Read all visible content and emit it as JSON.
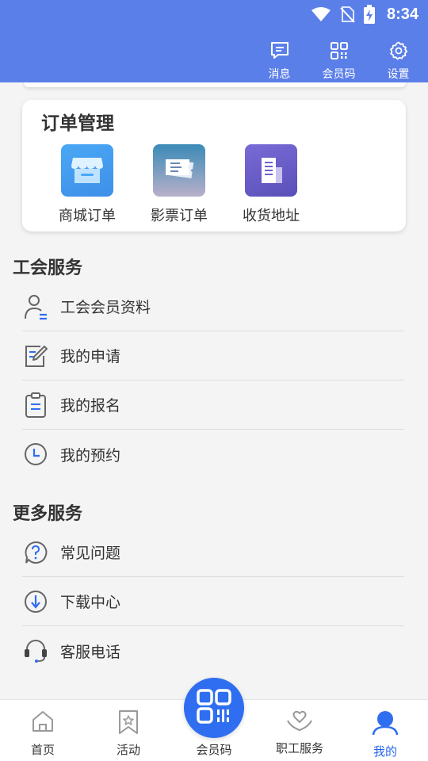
{
  "status_bar": {
    "time": "8:34"
  },
  "header": {
    "actions": [
      {
        "label": "消息",
        "icon": "message-icon"
      },
      {
        "label": "会员码",
        "icon": "qr-code-icon"
      },
      {
        "label": "设置",
        "icon": "gear-icon"
      }
    ]
  },
  "order_management": {
    "title": "订单管理",
    "items": [
      {
        "label": "商城订单",
        "icon": "store-icon"
      },
      {
        "label": "影票订单",
        "icon": "ticket-icon"
      },
      {
        "label": "收货地址",
        "icon": "building-icon"
      }
    ]
  },
  "union_services": {
    "title": "工会服务",
    "items": [
      {
        "label": "工会会员资料",
        "icon": "member-profile-icon"
      },
      {
        "label": "我的申请",
        "icon": "edit-form-icon"
      },
      {
        "label": "我的报名",
        "icon": "clipboard-icon"
      },
      {
        "label": "我的预约",
        "icon": "clock-icon"
      }
    ]
  },
  "more_services": {
    "title": "更多服务",
    "items": [
      {
        "label": "常见问题",
        "icon": "question-icon"
      },
      {
        "label": "下载中心",
        "icon": "download-icon"
      },
      {
        "label": "客服电话",
        "icon": "headset-icon"
      }
    ]
  },
  "bottom_nav": {
    "items": [
      {
        "label": "首页",
        "icon": "home-icon"
      },
      {
        "label": "活动",
        "icon": "bookmark-star-icon"
      },
      {
        "label": "会员码",
        "icon": "qr-code-icon"
      },
      {
        "label": "职工服务",
        "icon": "heart-hands-icon"
      },
      {
        "label": "我的",
        "icon": "user-icon"
      }
    ],
    "active": "我的"
  },
  "colors": {
    "header_bg": "#5b7fe8",
    "accent": "#2f6ef0",
    "active_nav": "#2563eb"
  }
}
